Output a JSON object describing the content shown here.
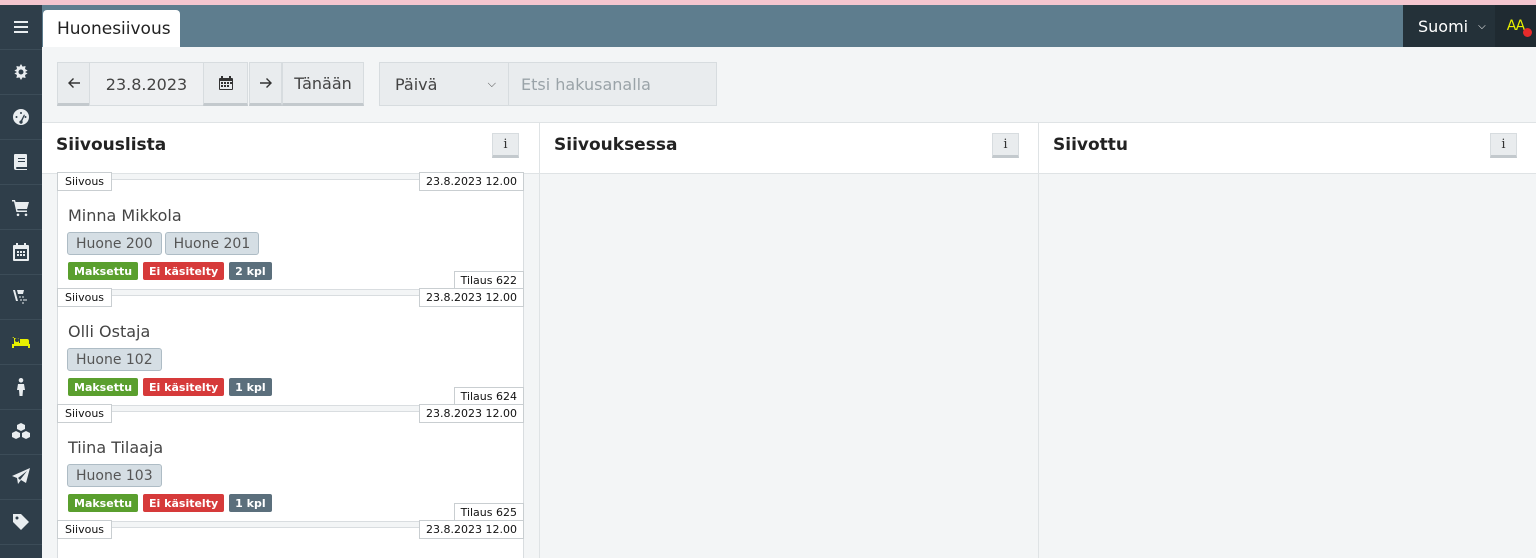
{
  "header": {
    "tab_label": "Huonesiivous",
    "language": "Suomi",
    "user_initials": "AA"
  },
  "sidebar": {
    "items": [
      {
        "icon": "menu-icon"
      },
      {
        "icon": "settings-cog-icon"
      },
      {
        "icon": "dashboard-icon"
      },
      {
        "icon": "book-icon"
      },
      {
        "icon": "cart-icon"
      },
      {
        "icon": "calendar-icon"
      },
      {
        "icon": "shower-icon"
      },
      {
        "icon": "bed-icon",
        "active": true
      },
      {
        "icon": "person-icon"
      },
      {
        "icon": "cubes-icon"
      },
      {
        "icon": "paper-plane-icon"
      },
      {
        "icon": "tag-icon"
      }
    ]
  },
  "toolbar": {
    "date_value": "23.8.2023",
    "today_label": "Tänään",
    "view_select": "Päivä",
    "search_placeholder": "Etsi hakusanalla"
  },
  "columns": [
    {
      "title": "Siivouslista",
      "info": "i"
    },
    {
      "title": "Siivouksessa",
      "info": "i"
    },
    {
      "title": "Siivottu",
      "info": "i"
    }
  ],
  "cards": [
    {
      "type": "Siivous",
      "date": "23.8.2023 12.00",
      "name": "Minna Mikkola",
      "rooms": [
        "Huone 200",
        "Huone 201"
      ],
      "paid": "Maksettu",
      "status": "Ei käsitelty",
      "qty": "2 kpl",
      "order": "Tilaus 622"
    },
    {
      "type": "Siivous",
      "date": "23.8.2023 12.00",
      "name": "Olli Ostaja",
      "rooms": [
        "Huone 102"
      ],
      "paid": "Maksettu",
      "status": "Ei käsitelty",
      "qty": "1 kpl",
      "order": "Tilaus 624"
    },
    {
      "type": "Siivous",
      "date": "23.8.2023 12.00",
      "name": "Tiina Tilaaja",
      "rooms": [
        "Huone 103"
      ],
      "paid": "Maksettu",
      "status": "Ei käsitelty",
      "qty": "1 kpl",
      "order": "Tilaus 625"
    },
    {
      "type": "Siivous",
      "date": "23.8.2023 12.00"
    }
  ],
  "colors": {
    "sidebar_bg": "#2f3e4a",
    "header_bg": "#5e7d8e",
    "active_icon": "#e8f000",
    "paid_badge": "#5a9f2e",
    "status_badge": "#d63a3a",
    "qty_badge": "#5b6f7c"
  }
}
